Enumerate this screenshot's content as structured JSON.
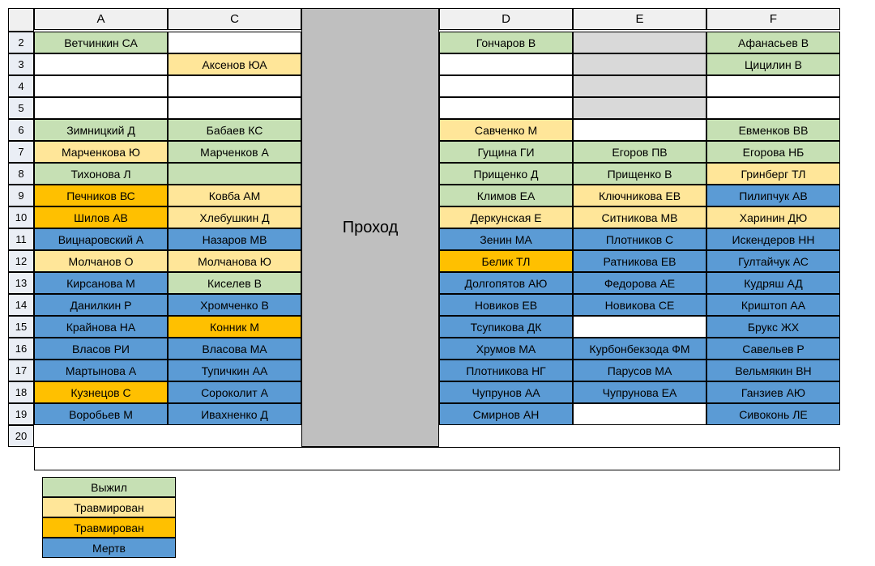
{
  "passage_label": "Проход",
  "columns": [
    "A",
    "C",
    "D",
    "E",
    "F"
  ],
  "row_numbers": [
    2,
    3,
    4,
    5,
    6,
    7,
    8,
    9,
    10,
    11,
    12,
    13,
    14,
    15,
    16,
    17,
    18,
    19,
    20
  ],
  "colors": {
    "green": "#c6e0b4",
    "yellow": "#ffe699",
    "orange": "#ffc000",
    "blue": "#5b9bd5",
    "grey": "#d9d9d9",
    "white": "#ffffff"
  },
  "rows": [
    {
      "n": 2,
      "A": {
        "t": "Ветчинкин СА",
        "c": "green"
      },
      "C": {
        "t": "",
        "c": "white"
      },
      "D": {
        "t": "Гончаров В",
        "c": "green"
      },
      "E": {
        "t": "",
        "c": "grey"
      },
      "F": {
        "t": "Афанасьев В",
        "c": "green"
      }
    },
    {
      "n": 3,
      "A": {
        "t": "",
        "c": "white"
      },
      "C": {
        "t": "Аксенов ЮА",
        "c": "yellow"
      },
      "D": {
        "t": "",
        "c": "white"
      },
      "E": {
        "t": "",
        "c": "grey"
      },
      "F": {
        "t": "Цицилин В",
        "c": "green"
      }
    },
    {
      "n": 4,
      "A": {
        "t": "",
        "c": "white"
      },
      "C": {
        "t": "",
        "c": "white"
      },
      "D": {
        "t": "",
        "c": "white"
      },
      "E": {
        "t": "",
        "c": "grey"
      },
      "F": {
        "t": "",
        "c": "white"
      }
    },
    {
      "n": 5,
      "A": {
        "t": "",
        "c": "white"
      },
      "C": {
        "t": "",
        "c": "white"
      },
      "D": {
        "t": "",
        "c": "white"
      },
      "E": {
        "t": "",
        "c": "grey"
      },
      "F": {
        "t": "",
        "c": "white"
      }
    },
    {
      "n": 6,
      "A": {
        "t": "Зимницкий Д",
        "c": "green"
      },
      "C": {
        "t": "Бабаев КС",
        "c": "green"
      },
      "D": {
        "t": "Савченко М",
        "c": "yellow"
      },
      "E": {
        "t": "",
        "c": "white"
      },
      "F": {
        "t": "Евменков ВВ",
        "c": "green"
      }
    },
    {
      "n": 7,
      "A": {
        "t": "Марченкова Ю",
        "c": "yellow"
      },
      "C": {
        "t": "Марченков А",
        "c": "green"
      },
      "D": {
        "t": "Гущина ГИ",
        "c": "green"
      },
      "E": {
        "t": "Егоров ПВ",
        "c": "green"
      },
      "F": {
        "t": "Егорова НБ",
        "c": "green"
      }
    },
    {
      "n": 8,
      "A": {
        "t": "Тихонова Л",
        "c": "green"
      },
      "C": {
        "t": "",
        "c": "green"
      },
      "D": {
        "t": "Прищенко Д",
        "c": "green"
      },
      "E": {
        "t": "Прищенко В",
        "c": "green"
      },
      "F": {
        "t": "Гринберг ТЛ",
        "c": "yellow"
      }
    },
    {
      "n": 9,
      "A": {
        "t": "Печников ВС",
        "c": "orange"
      },
      "C": {
        "t": "Ковба АМ",
        "c": "yellow"
      },
      "D": {
        "t": "Климов ЕА",
        "c": "green"
      },
      "E": {
        "t": "Ключникова ЕВ",
        "c": "yellow"
      },
      "F": {
        "t": "Пилипчук АВ",
        "c": "blue"
      }
    },
    {
      "n": 10,
      "A": {
        "t": "Шилов АВ",
        "c": "orange"
      },
      "C": {
        "t": "Хлебушкин Д",
        "c": "yellow"
      },
      "D": {
        "t": "Деркунская Е",
        "c": "yellow"
      },
      "E": {
        "t": "Ситникова МВ",
        "c": "yellow"
      },
      "F": {
        "t": "Харинин ДЮ",
        "c": "yellow"
      }
    },
    {
      "n": 11,
      "A": {
        "t": "Вицнаровский А",
        "c": "blue"
      },
      "C": {
        "t": "Назаров МВ",
        "c": "blue"
      },
      "D": {
        "t": "Зенин МА",
        "c": "blue"
      },
      "E": {
        "t": "Плотников С",
        "c": "blue"
      },
      "F": {
        "t": "Искендеров НН",
        "c": "blue"
      }
    },
    {
      "n": 12,
      "A": {
        "t": "Молчанов О",
        "c": "yellow"
      },
      "C": {
        "t": "Молчанова Ю",
        "c": "yellow"
      },
      "D": {
        "t": "Белик ТЛ",
        "c": "orange"
      },
      "E": {
        "t": "Ратникова ЕВ",
        "c": "blue"
      },
      "F": {
        "t": "Гултайчук АС",
        "c": "blue"
      }
    },
    {
      "n": 13,
      "A": {
        "t": "Кирсанова М",
        "c": "blue"
      },
      "C": {
        "t": "Киселев В",
        "c": "green"
      },
      "D": {
        "t": "Долгопятов АЮ",
        "c": "blue"
      },
      "E": {
        "t": "Федорова АЕ",
        "c": "blue"
      },
      "F": {
        "t": "Кудряш АД",
        "c": "blue"
      }
    },
    {
      "n": 14,
      "A": {
        "t": "Данилкин Р",
        "c": "blue"
      },
      "C": {
        "t": "Хромченко В",
        "c": "blue"
      },
      "D": {
        "t": "Новиков ЕВ",
        "c": "blue"
      },
      "E": {
        "t": "Новикова СЕ",
        "c": "blue"
      },
      "F": {
        "t": "Криштоп АА",
        "c": "blue"
      }
    },
    {
      "n": 15,
      "A": {
        "t": "Крайнова НА",
        "c": "blue"
      },
      "C": {
        "t": "Конник М",
        "c": "orange"
      },
      "D": {
        "t": "Тсупикова ДК",
        "c": "blue"
      },
      "E": {
        "t": "",
        "c": "white"
      },
      "F": {
        "t": "Брукс ЖХ",
        "c": "blue"
      }
    },
    {
      "n": 16,
      "A": {
        "t": "Власов РИ",
        "c": "blue"
      },
      "C": {
        "t": "Власова МА",
        "c": "blue"
      },
      "D": {
        "t": "Хрумов МА",
        "c": "blue"
      },
      "E": {
        "t": "Курбонбекзода  ФМ",
        "c": "blue"
      },
      "F": {
        "t": "Савельев Р",
        "c": "blue"
      }
    },
    {
      "n": 17,
      "A": {
        "t": "Мартынова А",
        "c": "blue"
      },
      "C": {
        "t": "Тупичкин АА",
        "c": "blue"
      },
      "D": {
        "t": "Плотникова НГ",
        "c": "blue"
      },
      "E": {
        "t": "Парусов МА",
        "c": "blue"
      },
      "F": {
        "t": "Вельмякин ВН",
        "c": "blue"
      }
    },
    {
      "n": 18,
      "A": {
        "t": "Кузнецов С",
        "c": "orange"
      },
      "C": {
        "t": "Сороколит А",
        "c": "blue"
      },
      "D": {
        "t": "Чупрунов АА",
        "c": "blue"
      },
      "E": {
        "t": "Чупрунова ЕА",
        "c": "blue"
      },
      "F": {
        "t": "Ганзиев АЮ",
        "c": "blue"
      }
    },
    {
      "n": 19,
      "A": {
        "t": "Воробьев М",
        "c": "blue"
      },
      "C": {
        "t": "Ивахненко Д",
        "c": "blue"
      },
      "D": {
        "t": "Смирнов АН",
        "c": "blue"
      },
      "E": {
        "t": "",
        "c": "white"
      },
      "F": {
        "t": "Сивоконь ЛЕ",
        "c": "blue"
      }
    }
  ],
  "legend": [
    {
      "t": "Выжил",
      "c": "green"
    },
    {
      "t": "Травмирован",
      "c": "yellow"
    },
    {
      "t": "Травмирован",
      "c": "orange"
    },
    {
      "t": "Мертв",
      "c": "blue"
    }
  ]
}
